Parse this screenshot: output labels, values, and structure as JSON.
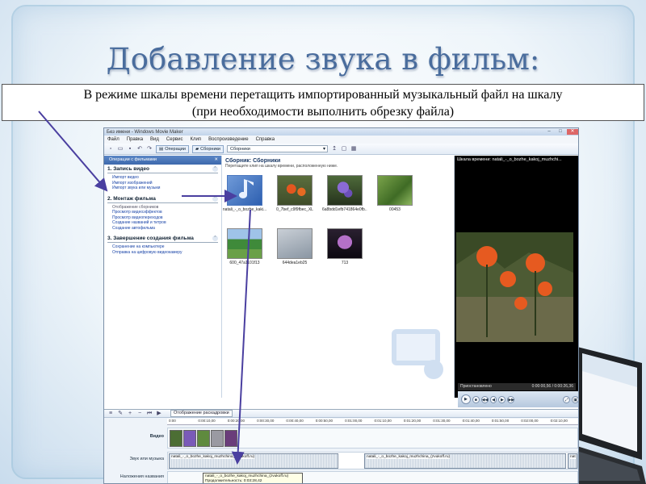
{
  "slide": {
    "title": "Добавление звука в фильм:",
    "callout_line1": "В режиме шкалы времени перетащить импортированный музыкальный файл на шкалу",
    "callout_line2": "(при необходимости выполнить обрезку файла)"
  },
  "window": {
    "title": "Без имени - Windows Movie Maker",
    "menu": [
      "Файл",
      "Правка",
      "Вид",
      "Сервис",
      "Клип",
      "Воспроизведение",
      "Справка"
    ],
    "toolbar": {
      "operations_label": "Операции",
      "collections_label": "Сборники",
      "collection_combo": "Сборники"
    }
  },
  "tasks": {
    "header": "Операции с фильмами",
    "sections": [
      {
        "title": "1. Запись видео",
        "items": [
          "Импорт видео",
          "Импорт изображений",
          "Импорт звука или музыки"
        ],
        "style": "link"
      },
      {
        "title": "2. Монтаж фильма",
        "items": [
          "Отображение сборников",
          "Просмотр видеоэффектов",
          "Просмотр видеопереходов",
          "Создание названий и титров",
          "Создание автофильма"
        ],
        "style": "mixed"
      },
      {
        "title": "3. Завершение создания фильма",
        "items": [
          "Сохранение на компьютере",
          "Отправка на цифровую видеокамеру"
        ],
        "style": "link"
      }
    ]
  },
  "collection": {
    "title": "Сборник: Сборники",
    "subtitle": "Перетащите клип на шкалу времени, расположенную ниже.",
    "clips": [
      {
        "caption": "natali_-_o_bozhe_kaki...",
        "kind": "audio"
      },
      {
        "caption": "0_7bef_c9f9fbec_XL",
        "kind": "flowers-red"
      },
      {
        "caption": "6a8bdd1efb741864e0fb...",
        "kind": "flowers-purple"
      },
      {
        "caption": "00453",
        "kind": "leaves"
      },
      {
        "caption": "600_47a1101f13",
        "kind": "house"
      },
      {
        "caption": "644dea1eb25",
        "kind": "sketch"
      },
      {
        "caption": "713",
        "kind": "lilac"
      }
    ]
  },
  "preview": {
    "title": "Шкала времени: natali_-_o_bozhe_kakoj_muzhchi...",
    "status": "Приостановлено",
    "time": "0:00:00,56 / 0:00:26,36"
  },
  "timeline": {
    "toggle_label": "Отображение раскадровки",
    "ticks": [
      "0:00",
      "0:00:10,00",
      "0:00:20,00",
      "0:00:30,00",
      "0:00:40,00",
      "0:00:50,00",
      "0:01:00,00",
      "0:01:10,00",
      "0:01:20,00",
      "0:01:30,00",
      "0:01:40,00",
      "0:01:50,00",
      "0:02:00,00",
      "0:02:10,00"
    ],
    "video_label": "Видео",
    "audio_label": "Звук или музыка",
    "titles_label": "Наложения названия",
    "audio_clip1": "natali_-_o_bozhe_kakoj_muzhchina_(zvukoff.ru)",
    "audio_clip2": "natali_-_o_bozhe_kakoj_muzhchina_(zvukoff.ru)",
    "audio_tail": "nat",
    "tooltip_line1": "natali_-_o_bozhe_kakoj_muzhchina_(zvukoff.ru)",
    "tooltip_line2": "Продолжительность: 0:03:28,42"
  },
  "colors": {
    "title": "#4a6d9d",
    "arrow": "#4a3fa0",
    "task_header": "#3d69ad"
  }
}
